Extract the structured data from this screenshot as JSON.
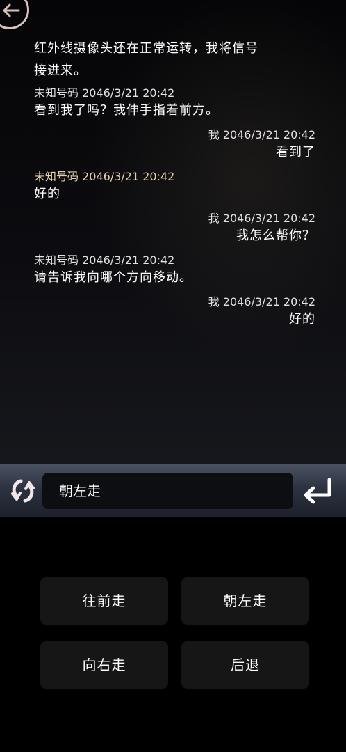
{
  "chat": {
    "intro": "红外线摄像头还在正常运转，我将信号接进来。",
    "messages": [
      {
        "side": "left",
        "meta": "未知号码 2046/3/21 20:42",
        "text": "看到我了吗？我伸手指着前方。"
      },
      {
        "side": "right",
        "meta": "我 2046/3/21 20:42",
        "text": "看到了"
      },
      {
        "side": "left",
        "meta": "未知号码 2046/3/21 20:42",
        "text": "好的"
      },
      {
        "side": "right",
        "meta": "我 2046/3/21 20:42",
        "text": "我怎么帮你？"
      },
      {
        "side": "left",
        "meta": "未知号码 2046/3/21 20:42",
        "text": "请告诉我向哪个方向移动。"
      },
      {
        "side": "right",
        "meta": "我 2046/3/21 20:42",
        "text": "好的"
      }
    ]
  },
  "input": {
    "value": "朝左走"
  },
  "options": [
    "往前走",
    "朝左走",
    "向右走",
    "后退"
  ],
  "colors": {
    "meta_gold": "#e6d2ad",
    "back_ring": "#d8c2c0",
    "button_bg": "#161616"
  }
}
